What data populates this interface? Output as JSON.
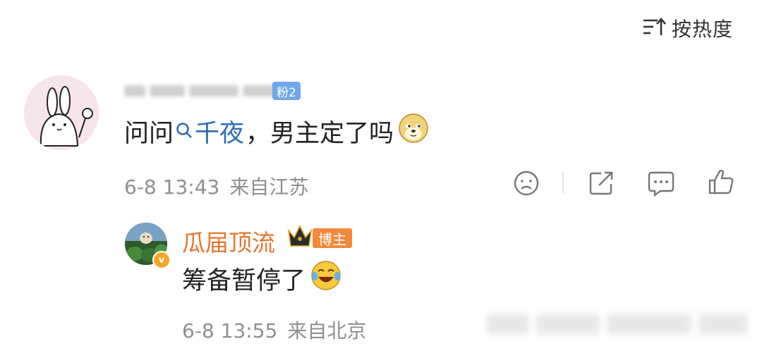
{
  "sort": {
    "label": "按热度",
    "icon": "sort-icon"
  },
  "comment": {
    "user_badge": "粉2",
    "text_prefix": "问问",
    "topic": "千夜",
    "text_suffix": "，男主定了吗",
    "emoji": "doge-emoji",
    "date": "6-8 13:43",
    "location": "来自江苏",
    "actions": [
      "dislike-icon",
      "share-icon",
      "comment-icon",
      "like-icon"
    ]
  },
  "reply": {
    "username": "瓜届顶流",
    "badge": "博主",
    "verified_mark": "v",
    "text": "筹备暂停了",
    "emoji": "laughing-crying-emoji",
    "date": "6-8 13:55",
    "location": "来自北京"
  }
}
